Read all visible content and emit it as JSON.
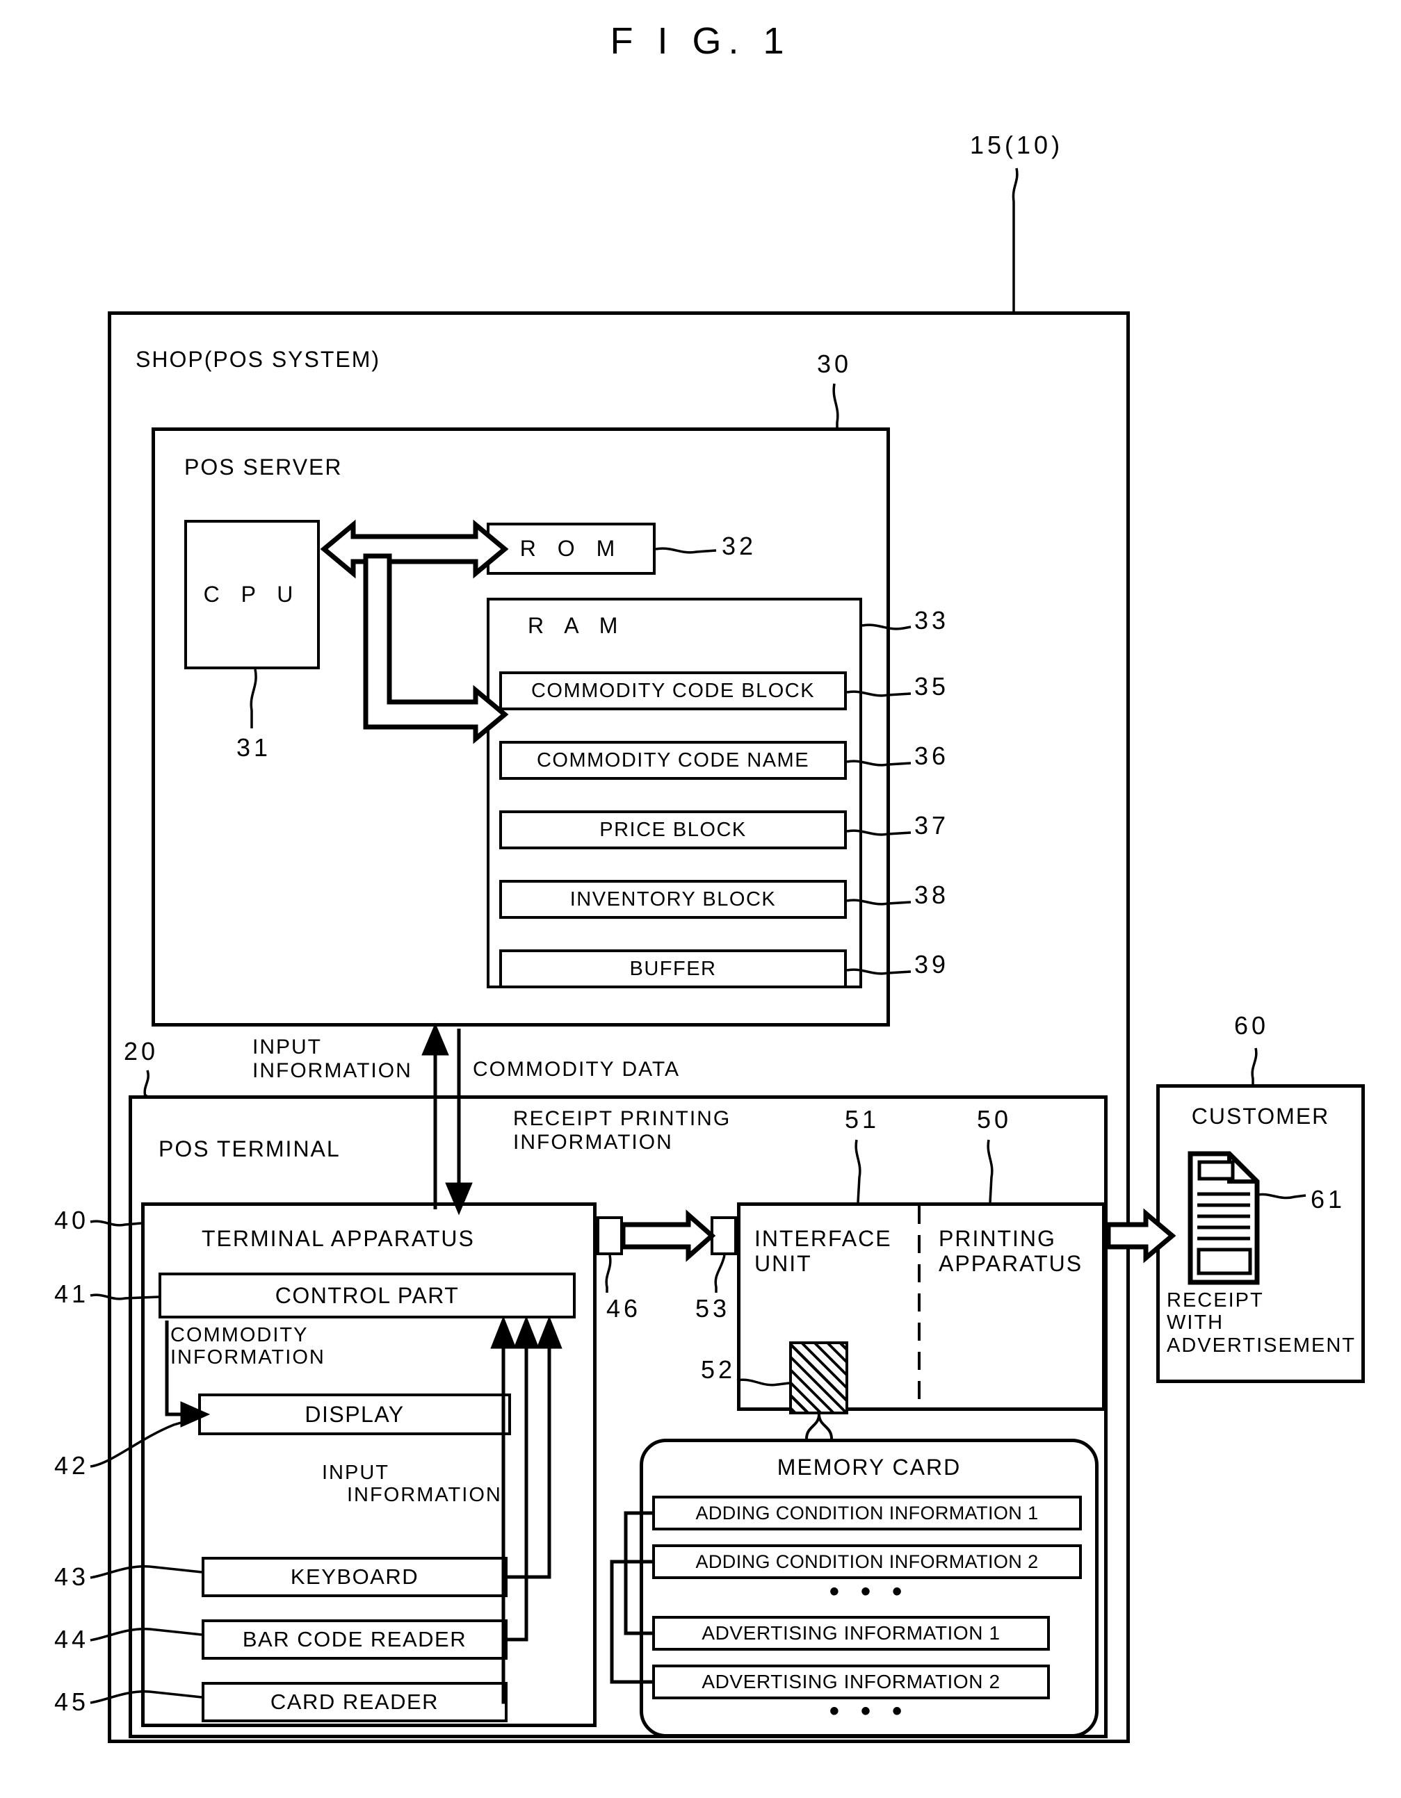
{
  "figure": {
    "title": "F I G. 1"
  },
  "shop": {
    "label": "SHOP(POS SYSTEM)",
    "ref": "15(10)"
  },
  "pos_server": {
    "label": "POS SERVER",
    "ref": "30",
    "cpu": {
      "label": "C P U",
      "ref": "31"
    },
    "rom": {
      "label": "R O M",
      "ref": "32"
    },
    "ram": {
      "label": "R A M",
      "ref": "33",
      "blocks": [
        {
          "label": "COMMODITY CODE BLOCK",
          "ref": "35"
        },
        {
          "label": "COMMODITY CODE NAME",
          "ref": "36"
        },
        {
          "label": "PRICE BLOCK",
          "ref": "37"
        },
        {
          "label": "INVENTORY BLOCK",
          "ref": "38"
        },
        {
          "label": "BUFFER",
          "ref": "39"
        }
      ]
    }
  },
  "flows": {
    "input_information_top": "INPUT\nINFORMATION",
    "input_information_line1": "INPUT",
    "input_information_line2": "INFORMATION",
    "commodity_data": "COMMODITY DATA",
    "receipt_printing_line1": "RECEIPT PRINTING",
    "receipt_printing_line2": "INFORMATION",
    "commodity_information_line1": "COMMODITY",
    "commodity_information_line2": "INFORMATION",
    "input_information_inner_line1": "INPUT",
    "input_information_inner_line2": "INFORMATION"
  },
  "pos_terminal": {
    "label": "POS TERMINAL",
    "ref": "20",
    "terminal_apparatus": {
      "label": "TERMINAL APPARATUS",
      "ref": "40",
      "control_part": {
        "label": "CONTROL PART",
        "ref": "41"
      },
      "display": {
        "label": "DISPLAY",
        "ref": "42"
      },
      "keyboard": {
        "label": "KEYBOARD",
        "ref": "43"
      },
      "bar_code_reader": {
        "label": "BAR CODE READER",
        "ref": "44"
      },
      "card_reader": {
        "label": "CARD READER",
        "ref": "45"
      },
      "connector_out": {
        "ref": "46"
      }
    },
    "printer": {
      "ref": "50",
      "interface_unit": {
        "label_line1": "INTERFACE",
        "label_line2": "UNIT",
        "ref": "51"
      },
      "printing_apparatus": {
        "label_line1": "PRINTING",
        "label_line2": "APPARATUS"
      },
      "memory_card_slot": {
        "ref": "52"
      },
      "connector_in": {
        "ref": "53"
      }
    },
    "memory_card": {
      "label": "MEMORY CARD",
      "items": [
        {
          "label": "ADDING CONDITION INFORMATION 1"
        },
        {
          "label": "ADDING CONDITION INFORMATION 2"
        },
        {
          "label": "ADVERTISING INFORMATION 1"
        },
        {
          "label": "ADVERTISING INFORMATION 2"
        }
      ],
      "ellipsis_mid": "• • •",
      "ellipsis_bottom": "• • •"
    }
  },
  "customer": {
    "label": "CUSTOMER",
    "ref": "60",
    "receipt": {
      "ref": "61",
      "caption_line1": "RECEIPT",
      "caption_line2": "WITH",
      "caption_line3": "ADVERTISEMENT"
    }
  },
  "colors": {
    "ink": "#000000",
    "paper": "#ffffff"
  }
}
